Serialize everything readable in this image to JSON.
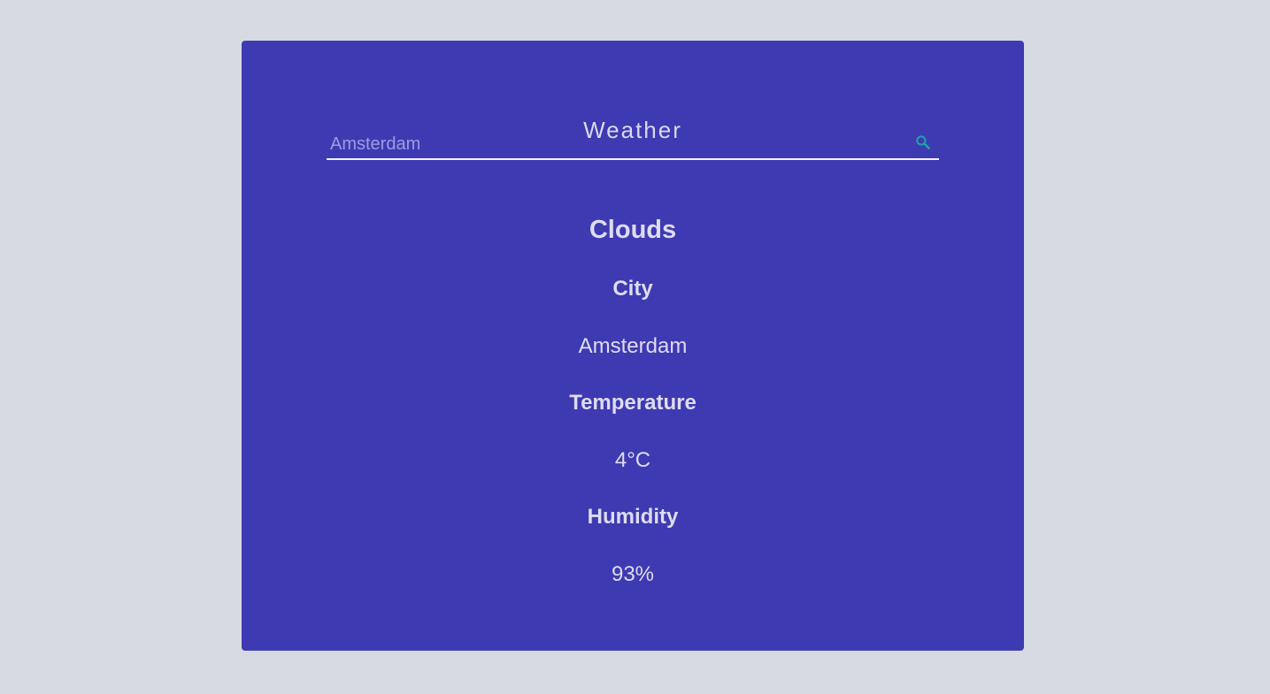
{
  "app": {
    "title": "Weather",
    "search": {
      "value": "",
      "placeholder": "Amsterdam",
      "icon": "search-icon"
    },
    "weather": {
      "condition": "Clouds",
      "city_label": "City",
      "city_value": "Amsterdam",
      "temperature_label": "Temperature",
      "temperature_value": "4°C",
      "humidity_label": "Humidity",
      "humidity_value": "93%"
    }
  },
  "colors": {
    "page_background": "#d6dae2",
    "card_background": "#3e3ab2",
    "text": "#dcdcf0",
    "search_icon": "#18a6a6",
    "input_underline": "#f2f2fa"
  }
}
